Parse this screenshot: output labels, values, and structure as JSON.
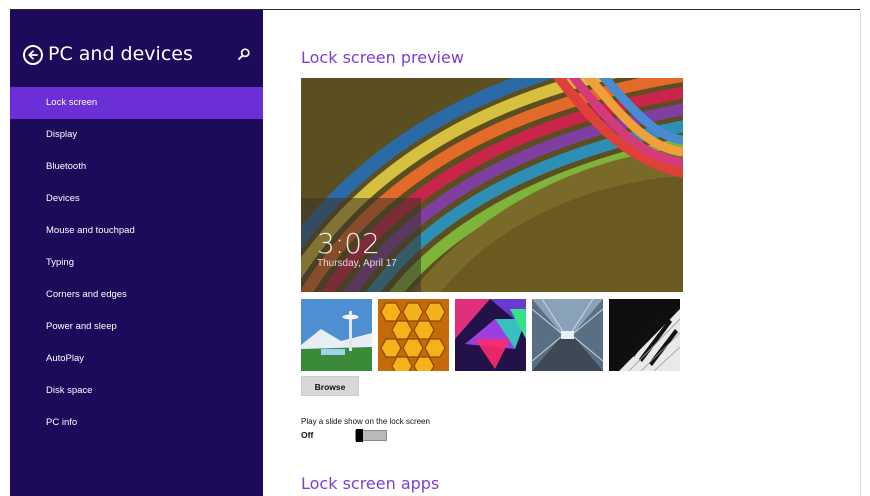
{
  "sidebar": {
    "title": "PC and devices",
    "back_icon": "back-arrow-icon",
    "search_icon": "search-icon",
    "accent_color": "#1d0a5a",
    "active_color": "#6a2fd6",
    "items": [
      {
        "label": "Lock screen",
        "active": true
      },
      {
        "label": "Display",
        "active": false
      },
      {
        "label": "Bluetooth",
        "active": false
      },
      {
        "label": "Devices",
        "active": false
      },
      {
        "label": "Mouse and touchpad",
        "active": false
      },
      {
        "label": "Typing",
        "active": false
      },
      {
        "label": "Corners and edges",
        "active": false
      },
      {
        "label": "Power and sleep",
        "active": false
      },
      {
        "label": "AutoPlay",
        "active": false
      },
      {
        "label": "Disk space",
        "active": false
      },
      {
        "label": "PC info",
        "active": false
      }
    ]
  },
  "main": {
    "section_preview_title": "Lock screen preview",
    "preview": {
      "time": "3:02",
      "date": "Thursday, April 17"
    },
    "thumbnails": [
      {
        "name": "space-needle-thumbnail"
      },
      {
        "name": "honeycomb-thumbnail"
      },
      {
        "name": "geometric-shapes-thumbnail"
      },
      {
        "name": "tunnel-thumbnail"
      },
      {
        "name": "piano-keys-thumbnail"
      }
    ],
    "browse_label": "Browse",
    "slideshow_label": "Play a slide show on the lock screen",
    "slideshow_state": "Off",
    "section_apps_title": "Lock screen apps",
    "heading_color": "#7a3fd0"
  }
}
